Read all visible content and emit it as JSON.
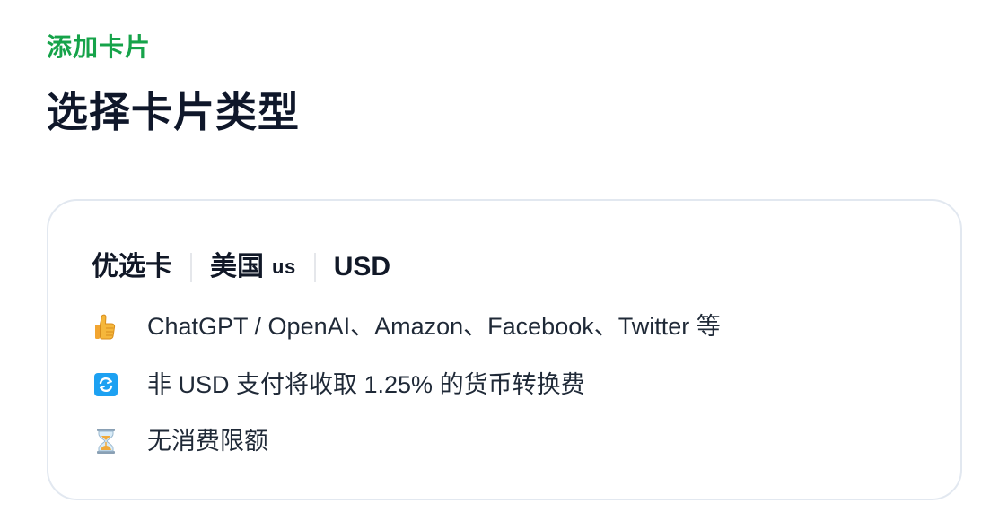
{
  "header": {
    "eyebrow": "添加卡片",
    "title": "选择卡片类型"
  },
  "card": {
    "card_type": "优选卡",
    "region": "美国",
    "region_code": "us",
    "currency": "USD",
    "features": [
      {
        "icon": "thumbs-up-icon",
        "text": "ChatGPT / OpenAI、Amazon、Facebook、Twitter 等"
      },
      {
        "icon": "currency-exchange-icon",
        "text": "非 USD 支付将收取 1.25% 的货币转换费"
      },
      {
        "icon": "hourglass-icon",
        "text": "无消费限额"
      }
    ]
  },
  "colors": {
    "accent": "#16a34a",
    "title": "#0f172a",
    "card_border": "#e2e8f0",
    "exchange_icon": "#1da1f2",
    "thumbs_icon": "#f5b73b",
    "hourglass_icon": "#f0a93a"
  }
}
